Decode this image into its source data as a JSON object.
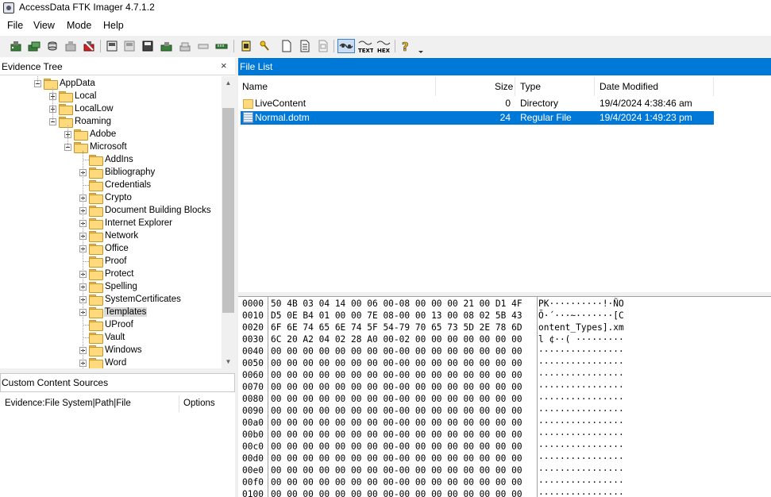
{
  "window": {
    "title": "AccessData FTK Imager 4.7.1.2"
  },
  "menu": [
    "File",
    "View",
    "Mode",
    "Help"
  ],
  "toolbar_icons": [
    "add-evidence-icon",
    "add-all-attached-icon",
    "image-mounting-icon",
    "remove-evidence-icon",
    "remove-all-evidence-icon",
    "create-disk-image-icon",
    "export-disk-image-icon",
    "export-logical-image-icon",
    "add-to-custom-content-icon",
    "create-custom-content-image-icon",
    "decrypt-ad1-icon",
    "verify-drive-icon",
    "capture-memory-icon",
    "obtain-protected-files-icon",
    "detect-encryption-icon",
    "export-files-icon",
    "export-file-hash-list-icon",
    "export-directory-listing-icon",
    "auto-view-icon",
    "text-view-icon",
    "hex-view-icon",
    "help-icon",
    "toolbar-options-icon"
  ],
  "evidence_tree": {
    "title": "Evidence Tree",
    "close_glyph": "×",
    "nodes": [
      {
        "label": "AppData",
        "level": 0,
        "expander": "minus"
      },
      {
        "label": "Local",
        "level": 1,
        "expander": "plus"
      },
      {
        "label": "LocalLow",
        "level": 1,
        "expander": "plus"
      },
      {
        "label": "Roaming",
        "level": 1,
        "expander": "minus"
      },
      {
        "label": "Adobe",
        "level": 2,
        "expander": "plus"
      },
      {
        "label": "Microsoft",
        "level": 2,
        "expander": "minus"
      },
      {
        "label": "AddIns",
        "level": 3,
        "expander": "none"
      },
      {
        "label": "Bibliography",
        "level": 3,
        "expander": "plus"
      },
      {
        "label": "Credentials",
        "level": 3,
        "expander": "none"
      },
      {
        "label": "Crypto",
        "level": 3,
        "expander": "plus"
      },
      {
        "label": "Document Building Blocks",
        "level": 3,
        "expander": "plus"
      },
      {
        "label": "Internet Explorer",
        "level": 3,
        "expander": "plus"
      },
      {
        "label": "Network",
        "level": 3,
        "expander": "plus"
      },
      {
        "label": "Office",
        "level": 3,
        "expander": "plus"
      },
      {
        "label": "Proof",
        "level": 3,
        "expander": "none"
      },
      {
        "label": "Protect",
        "level": 3,
        "expander": "plus"
      },
      {
        "label": "Spelling",
        "level": 3,
        "expander": "plus"
      },
      {
        "label": "SystemCertificates",
        "level": 3,
        "expander": "plus"
      },
      {
        "label": "Templates",
        "level": 3,
        "expander": "plus",
        "selected": true
      },
      {
        "label": "UProof",
        "level": 3,
        "expander": "none"
      },
      {
        "label": "Vault",
        "level": 3,
        "expander": "none"
      },
      {
        "label": "Windows",
        "level": 3,
        "expander": "plus"
      },
      {
        "label": "Word",
        "level": 3,
        "expander": "plus"
      }
    ]
  },
  "custom_content": {
    "title": "Custom Content Sources",
    "columns": [
      "Evidence:File System|Path|File",
      "Options"
    ]
  },
  "file_list": {
    "title": "File List",
    "columns": [
      "Name",
      "Size",
      "Type",
      "Date Modified"
    ],
    "rows": [
      {
        "name": "LiveContent",
        "size": "0",
        "type": "Directory",
        "modified": "19/4/2024 4:38:46 am",
        "icon": "folder-icon",
        "selected": false
      },
      {
        "name": "Normal.dotm",
        "size": "24",
        "type": "Regular File",
        "modified": "19/4/2024 1:49:23 pm",
        "icon": "file-icon",
        "selected": true
      }
    ]
  },
  "hex_view": {
    "rows": [
      {
        "offset": "0000",
        "bytes": "50 4B 03 04 14 00 06 00-08 00 00 00 21 00 D1 4F",
        "ascii": "PK··········!·ÑO"
      },
      {
        "offset": "0010",
        "bytes": "D5 0E B4 01 00 00 7E 08-00 00 13 00 08 02 5B 43",
        "ascii": "Õ·´···~·······[C"
      },
      {
        "offset": "0020",
        "bytes": "6F 6E 74 65 6E 74 5F 54-79 70 65 73 5D 2E 78 6D",
        "ascii": "ontent_Types].xm"
      },
      {
        "offset": "0030",
        "bytes": "6C 20 A2 04 02 28 A0 00-02 00 00 00 00 00 00 00",
        "ascii": "l ¢··( ·········"
      },
      {
        "offset": "0040",
        "bytes": "00 00 00 00 00 00 00 00-00 00 00 00 00 00 00 00",
        "ascii": "················"
      },
      {
        "offset": "0050",
        "bytes": "00 00 00 00 00 00 00 00-00 00 00 00 00 00 00 00",
        "ascii": "················"
      },
      {
        "offset": "0060",
        "bytes": "00 00 00 00 00 00 00 00-00 00 00 00 00 00 00 00",
        "ascii": "················"
      },
      {
        "offset": "0070",
        "bytes": "00 00 00 00 00 00 00 00-00 00 00 00 00 00 00 00",
        "ascii": "················"
      },
      {
        "offset": "0080",
        "bytes": "00 00 00 00 00 00 00 00-00 00 00 00 00 00 00 00",
        "ascii": "················"
      },
      {
        "offset": "0090",
        "bytes": "00 00 00 00 00 00 00 00-00 00 00 00 00 00 00 00",
        "ascii": "················"
      },
      {
        "offset": "00a0",
        "bytes": "00 00 00 00 00 00 00 00-00 00 00 00 00 00 00 00",
        "ascii": "················"
      },
      {
        "offset": "00b0",
        "bytes": "00 00 00 00 00 00 00 00-00 00 00 00 00 00 00 00",
        "ascii": "················"
      },
      {
        "offset": "00c0",
        "bytes": "00 00 00 00 00 00 00 00-00 00 00 00 00 00 00 00",
        "ascii": "················"
      },
      {
        "offset": "00d0",
        "bytes": "00 00 00 00 00 00 00 00-00 00 00 00 00 00 00 00",
        "ascii": "················"
      },
      {
        "offset": "00e0",
        "bytes": "00 00 00 00 00 00 00 00-00 00 00 00 00 00 00 00",
        "ascii": "················"
      },
      {
        "offset": "00f0",
        "bytes": "00 00 00 00 00 00 00 00-00 00 00 00 00 00 00 00",
        "ascii": "················"
      },
      {
        "offset": "0100",
        "bytes": "00 00 00 00 00 00 00 00-00 00 00 00 00 00 00 00",
        "ascii": "················"
      }
    ]
  },
  "colors": {
    "accent": "#0078d7",
    "selection_gray": "#d9d9d9"
  }
}
